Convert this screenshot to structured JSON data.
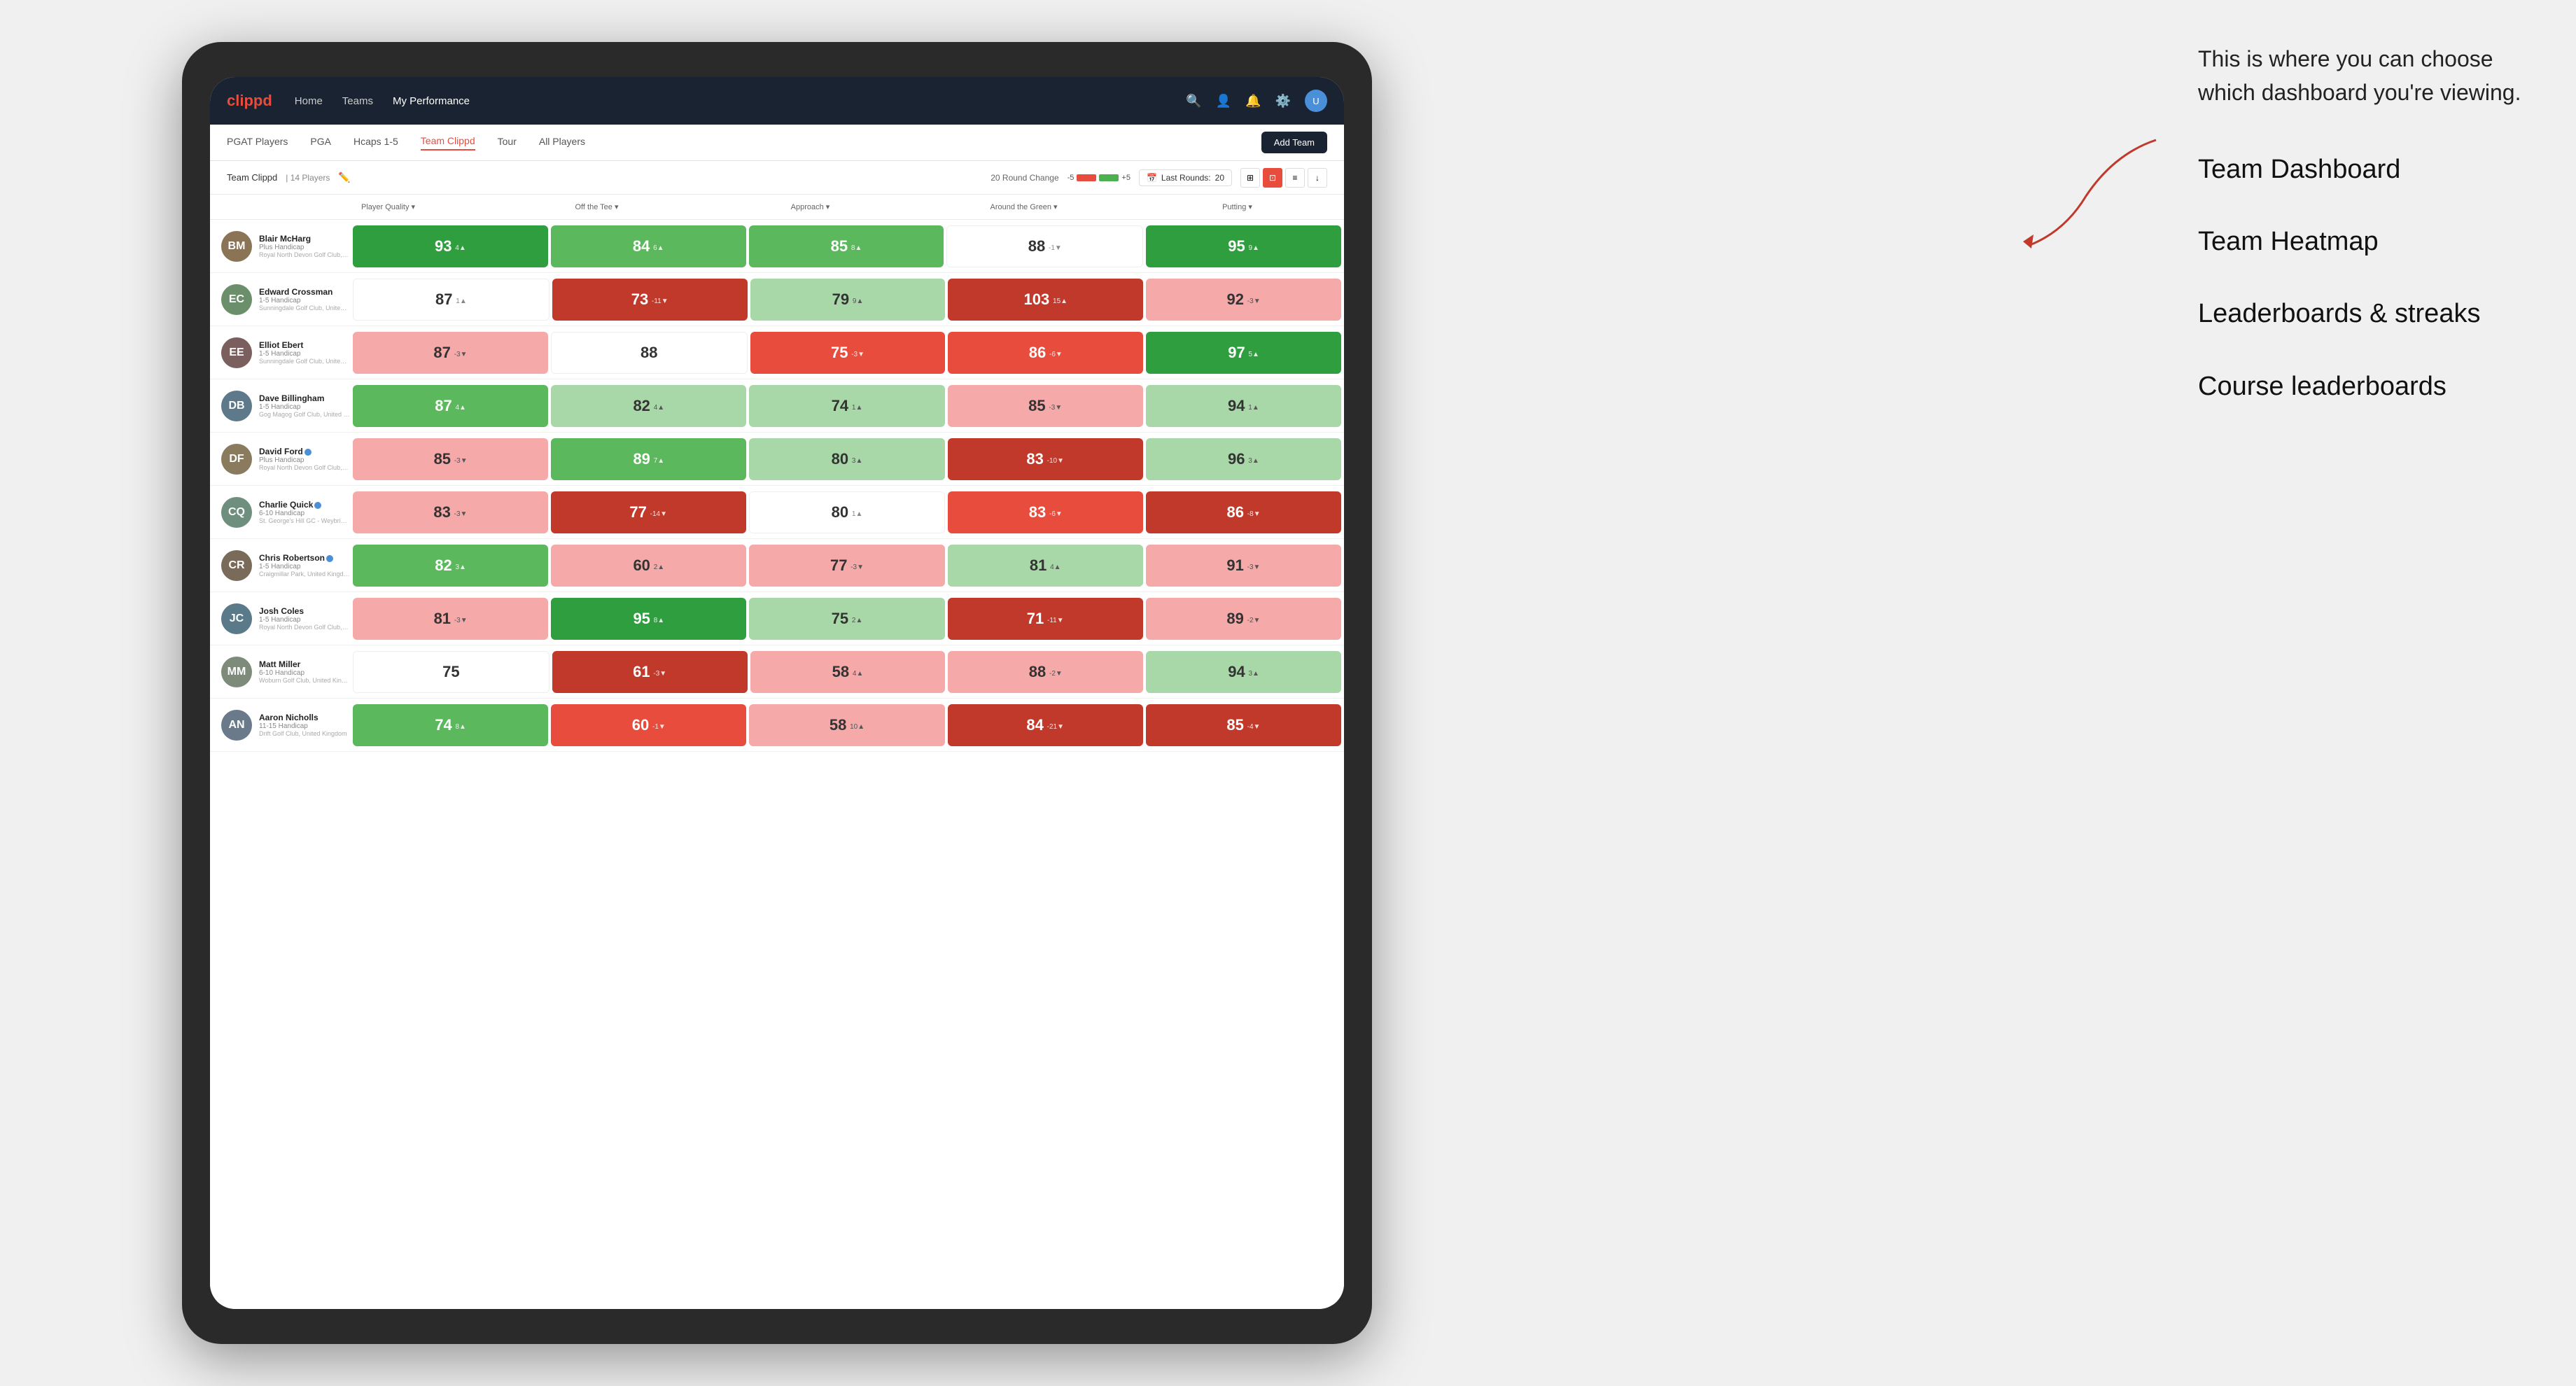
{
  "annotation": {
    "intro": "This is where you can choose which dashboard you're viewing.",
    "items": [
      "Team Dashboard",
      "Team Heatmap",
      "Leaderboards & streaks",
      "Course leaderboards"
    ]
  },
  "nav": {
    "logo": "clippd",
    "items": [
      "Home",
      "Teams",
      "My Performance"
    ],
    "active_item": "My Performance"
  },
  "sub_nav": {
    "items": [
      "PGAT Players",
      "PGA",
      "Hcaps 1-5",
      "Team Clippd",
      "Tour",
      "All Players"
    ],
    "active_item": "Team Clippd",
    "add_team_label": "Add Team"
  },
  "team_header": {
    "name": "Team Clippd",
    "separator": "|",
    "count": "14 Players",
    "round_change_label": "20 Round Change",
    "bar_neg": "-5",
    "bar_pos": "+5",
    "last_rounds_label": "Last Rounds:",
    "last_rounds_value": "20"
  },
  "column_headers": {
    "player": "Player Quality ▾",
    "off_tee": "Off the Tee ▾",
    "approach": "Approach ▾",
    "around_green": "Around the Green ▾",
    "putting": "Putting ▾"
  },
  "players": [
    {
      "name": "Blair McHarg",
      "handicap": "Plus Handicap",
      "club": "Royal North Devon Golf Club, United Kingdom",
      "initials": "BM",
      "bg": "#8B7355",
      "scores": {
        "quality": {
          "value": 93,
          "change": "4▲",
          "bg": "green-strong"
        },
        "off_tee": {
          "value": 84,
          "change": "6▲",
          "bg": "green-medium"
        },
        "approach": {
          "value": 85,
          "change": "8▲",
          "bg": "green-medium"
        },
        "around_green": {
          "value": 88,
          "change": "-1▼",
          "bg": "white"
        },
        "putting": {
          "value": 95,
          "change": "9▲",
          "bg": "green-strong"
        }
      }
    },
    {
      "name": "Edward Crossman",
      "handicap": "1-5 Handicap",
      "club": "Sunningdale Golf Club, United Kingdom",
      "initials": "EC",
      "bg": "#6B8E6B",
      "scores": {
        "quality": {
          "value": 87,
          "change": "1▲",
          "bg": "white"
        },
        "off_tee": {
          "value": 73,
          "change": "-11▼",
          "bg": "red-strong"
        },
        "approach": {
          "value": 79,
          "change": "9▲",
          "bg": "green-light"
        },
        "around_green": {
          "value": 103,
          "change": "15▲",
          "bg": "red-strong"
        },
        "putting": {
          "value": 92,
          "change": "-3▼",
          "bg": "red-light"
        }
      }
    },
    {
      "name": "Elliot Ebert",
      "handicap": "1-5 Handicap",
      "club": "Sunningdale Golf Club, United Kingdom",
      "initials": "EE",
      "bg": "#7B5E5E",
      "scores": {
        "quality": {
          "value": 87,
          "change": "-3▼",
          "bg": "red-light"
        },
        "off_tee": {
          "value": 88,
          "change": "",
          "bg": "white"
        },
        "approach": {
          "value": 75,
          "change": "-3▼",
          "bg": "red-medium"
        },
        "around_green": {
          "value": 86,
          "change": "-6▼",
          "bg": "red-medium"
        },
        "putting": {
          "value": 97,
          "change": "5▲",
          "bg": "green-strong"
        }
      }
    },
    {
      "name": "Dave Billingham",
      "handicap": "1-5 Handicap",
      "club": "Gog Magog Golf Club, United Kingdom",
      "initials": "DB",
      "bg": "#5E7A8A",
      "scores": {
        "quality": {
          "value": 87,
          "change": "4▲",
          "bg": "green-medium"
        },
        "off_tee": {
          "value": 82,
          "change": "4▲",
          "bg": "green-light"
        },
        "approach": {
          "value": 74,
          "change": "1▲",
          "bg": "green-light"
        },
        "around_green": {
          "value": 85,
          "change": "-3▼",
          "bg": "red-light"
        },
        "putting": {
          "value": 94,
          "change": "1▲",
          "bg": "green-light"
        }
      }
    },
    {
      "name": "David Ford",
      "handicap": "Plus Handicap",
      "club": "Royal North Devon Golf Club, United Kingdom",
      "initials": "DF",
      "verified": true,
      "bg": "#8A7A5E",
      "scores": {
        "quality": {
          "value": 85,
          "change": "-3▼",
          "bg": "red-light"
        },
        "off_tee": {
          "value": 89,
          "change": "7▲",
          "bg": "green-medium"
        },
        "approach": {
          "value": 80,
          "change": "3▲",
          "bg": "green-light"
        },
        "around_green": {
          "value": 83,
          "change": "-10▼",
          "bg": "red-strong"
        },
        "putting": {
          "value": 96,
          "change": "3▲",
          "bg": "green-light"
        }
      }
    },
    {
      "name": "Charlie Quick",
      "handicap": "6-10 Handicap",
      "club": "St. George's Hill GC - Weybridge - Surrey, Uni...",
      "initials": "CQ",
      "verified": true,
      "bg": "#6E8E7E",
      "scores": {
        "quality": {
          "value": 83,
          "change": "-3▼",
          "bg": "red-light"
        },
        "off_tee": {
          "value": 77,
          "change": "-14▼",
          "bg": "red-strong"
        },
        "approach": {
          "value": 80,
          "change": "1▲",
          "bg": "white"
        },
        "around_green": {
          "value": 83,
          "change": "-6▼",
          "bg": "red-medium"
        },
        "putting": {
          "value": 86,
          "change": "-8▼",
          "bg": "red-strong"
        }
      }
    },
    {
      "name": "Chris Robertson",
      "handicap": "1-5 Handicap",
      "club": "Craigmillar Park, United Kingdom",
      "initials": "CR",
      "verified": true,
      "bg": "#7A6A5A",
      "scores": {
        "quality": {
          "value": 82,
          "change": "3▲",
          "bg": "green-medium"
        },
        "off_tee": {
          "value": 60,
          "change": "2▲",
          "bg": "red-light"
        },
        "approach": {
          "value": 77,
          "change": "-3▼",
          "bg": "red-light"
        },
        "around_green": {
          "value": 81,
          "change": "4▲",
          "bg": "green-light"
        },
        "putting": {
          "value": 91,
          "change": "-3▼",
          "bg": "red-light"
        }
      }
    },
    {
      "name": "Josh Coles",
      "handicap": "1-5 Handicap",
      "club": "Royal North Devon Golf Club, United Kingdom",
      "initials": "JC",
      "bg": "#5A7A8A",
      "scores": {
        "quality": {
          "value": 81,
          "change": "-3▼",
          "bg": "red-light"
        },
        "off_tee": {
          "value": 95,
          "change": "8▲",
          "bg": "green-strong"
        },
        "approach": {
          "value": 75,
          "change": "2▲",
          "bg": "green-light"
        },
        "around_green": {
          "value": 71,
          "change": "-11▼",
          "bg": "red-strong"
        },
        "putting": {
          "value": 89,
          "change": "-2▼",
          "bg": "red-light"
        }
      }
    },
    {
      "name": "Matt Miller",
      "handicap": "6-10 Handicap",
      "club": "Woburn Golf Club, United Kingdom",
      "initials": "MM",
      "bg": "#7E8A7A",
      "scores": {
        "quality": {
          "value": 75,
          "change": "",
          "bg": "white"
        },
        "off_tee": {
          "value": 61,
          "change": "-3▼",
          "bg": "red-strong"
        },
        "approach": {
          "value": 58,
          "change": "4▲",
          "bg": "red-light"
        },
        "around_green": {
          "value": 88,
          "change": "-2▼",
          "bg": "red-light"
        },
        "putting": {
          "value": 94,
          "change": "3▲",
          "bg": "green-light"
        }
      }
    },
    {
      "name": "Aaron Nicholls",
      "handicap": "11-15 Handicap",
      "club": "Drift Golf Club, United Kingdom",
      "initials": "AN",
      "bg": "#6A7A8A",
      "scores": {
        "quality": {
          "value": 74,
          "change": "8▲",
          "bg": "green-medium"
        },
        "off_tee": {
          "value": 60,
          "change": "-1▼",
          "bg": "red-medium"
        },
        "approach": {
          "value": 58,
          "change": "10▲",
          "bg": "red-light"
        },
        "around_green": {
          "value": 84,
          "change": "-21▼",
          "bg": "red-strong"
        },
        "putting": {
          "value": 85,
          "change": "-4▼",
          "bg": "red-strong"
        }
      }
    }
  ],
  "colors": {
    "green_strong": "#2e9e3f",
    "green_medium": "#5cb85c",
    "green_light": "#a8d8a8",
    "red_strong": "#c0392b",
    "red_medium": "#e74c3c",
    "red_light": "#f5a9a9",
    "white": "#ffffff",
    "nav_bg": "#1a2332",
    "accent": "#e84c3d"
  }
}
